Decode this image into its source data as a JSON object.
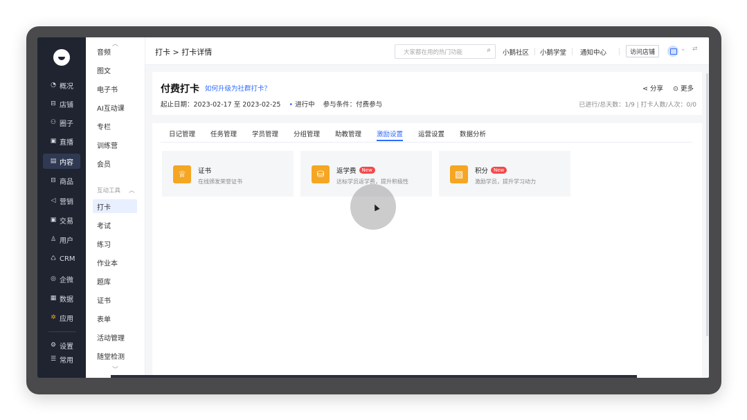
{
  "dark_sidebar": {
    "items": [
      {
        "icon": "◔",
        "label": "概况"
      },
      {
        "icon": "⊟",
        "label": "店铺"
      },
      {
        "icon": "⚇",
        "label": "圈子"
      },
      {
        "icon": "▣",
        "label": "直播"
      },
      {
        "icon": "▤",
        "label": "内容"
      },
      {
        "icon": "⊟",
        "label": "商品"
      },
      {
        "icon": "◁",
        "label": "营销"
      },
      {
        "icon": "▣",
        "label": "交易"
      },
      {
        "icon": "♙",
        "label": "用户"
      },
      {
        "icon": "♺",
        "label": "CRM"
      },
      {
        "icon": "◎",
        "label": "企微"
      },
      {
        "icon": "▦",
        "label": "数据"
      },
      {
        "icon": "✲",
        "label": "应用"
      }
    ],
    "bottom": [
      {
        "icon": "⚙",
        "label": "设置"
      },
      {
        "icon": "☰",
        "label": "常用"
      }
    ]
  },
  "light_sidebar": {
    "items_top": [
      "音频",
      "图文",
      "电子书",
      "AI互动课",
      "专栏",
      "训练营",
      "会员"
    ],
    "group_label": "互动工具",
    "items_group": [
      "打卡",
      "考试",
      "练习",
      "作业本",
      "题库",
      "证书",
      "表单",
      "活动管理",
      "随堂检测"
    ]
  },
  "topbar": {
    "breadcrumb": "打卡 > 打卡详情",
    "search_placeholder": "大家都在用的热门功能",
    "links": [
      "小鹅社区",
      "小鹅学堂",
      "通知中心"
    ],
    "visit_button": "访问店铺"
  },
  "header": {
    "title": "付费打卡",
    "upgrade_link": "如何升级为社群打卡？",
    "date_range": "起止日期：2023-02-17 至 2023-02-25",
    "status": "进行中",
    "condition": "参与条件：付费参与",
    "share": "分享",
    "more": "更多",
    "stats": "已进行/总天数：1/9  |  打卡人数/人次：0/0"
  },
  "tabs": [
    "日记管理",
    "任务管理",
    "学员管理",
    "分组管理",
    "助教管理",
    "激励设置",
    "运营设置",
    "数据分析"
  ],
  "active_tab": "激励设置",
  "incentives": [
    {
      "title": "证书",
      "badge": "",
      "desc": "在线颁发荣誉证书",
      "icon": "♕"
    },
    {
      "title": "返学费",
      "badge": "New",
      "desc": "达标学员返学费，提升积极性",
      "icon": "⛁"
    },
    {
      "title": "积分",
      "badge": "New",
      "desc": "激励学员，提升学习动力",
      "icon": "▨"
    }
  ]
}
